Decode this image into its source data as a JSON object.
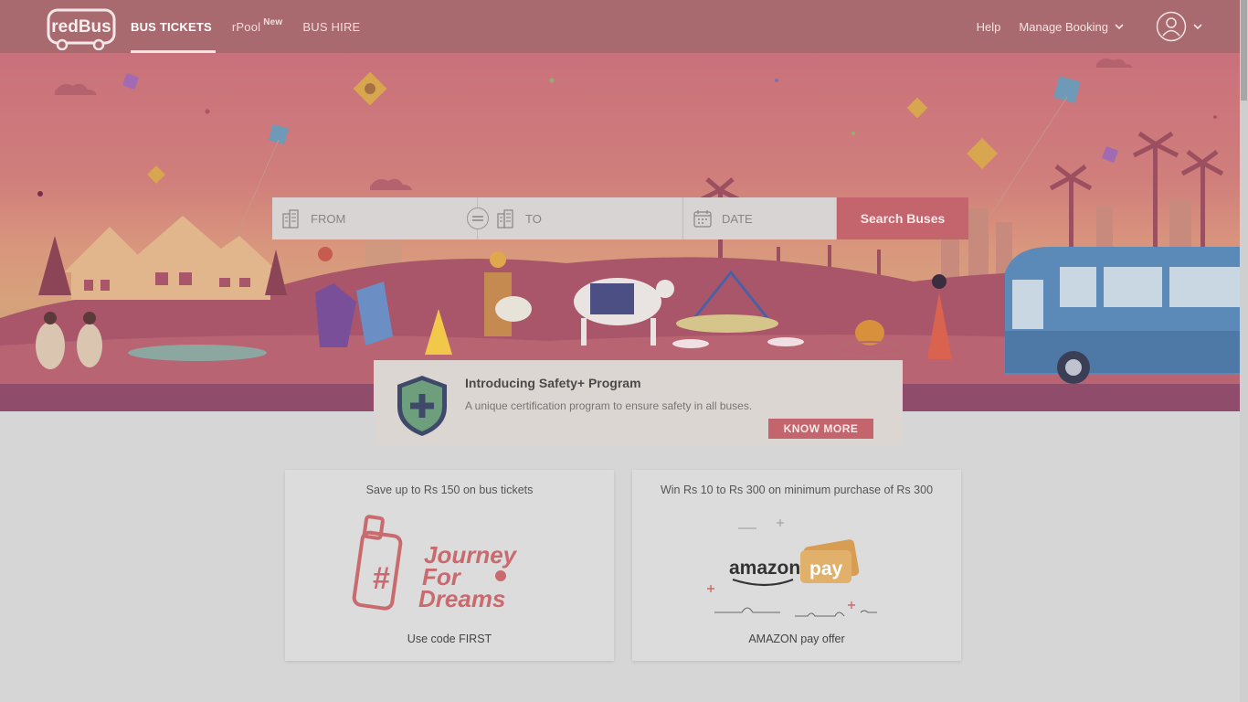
{
  "brand": {
    "logo_text": "redBus"
  },
  "nav": {
    "items": [
      {
        "label": "BUS TICKETS",
        "active": true
      },
      {
        "label": "rPool",
        "badge": "New",
        "active": false
      },
      {
        "label": "BUS HIRE",
        "active": false
      }
    ],
    "right": {
      "help": "Help",
      "manage": "Manage Booking"
    }
  },
  "search": {
    "from_placeholder": "FROM",
    "to_placeholder": "TO",
    "date_placeholder": "DATE",
    "button": "Search Buses"
  },
  "safety": {
    "title": "Introducing Safety+ Program",
    "description": "A unique certification program to ensure safety in all buses.",
    "button": "KNOW MORE"
  },
  "offers": [
    {
      "title": "Save up to Rs 150 on bus tickets",
      "art_text": "Journey For Dreams",
      "footer": "Use code FIRST"
    },
    {
      "title": "Win Rs 10 to Rs 300 on minimum purchase of Rs 300",
      "art_text": "amazon pay",
      "footer": "AMAZON pay offer"
    }
  ],
  "colors": {
    "brand": "#c4646c",
    "header": "#a86a6f",
    "page_bg": "#d6d6d6"
  }
}
